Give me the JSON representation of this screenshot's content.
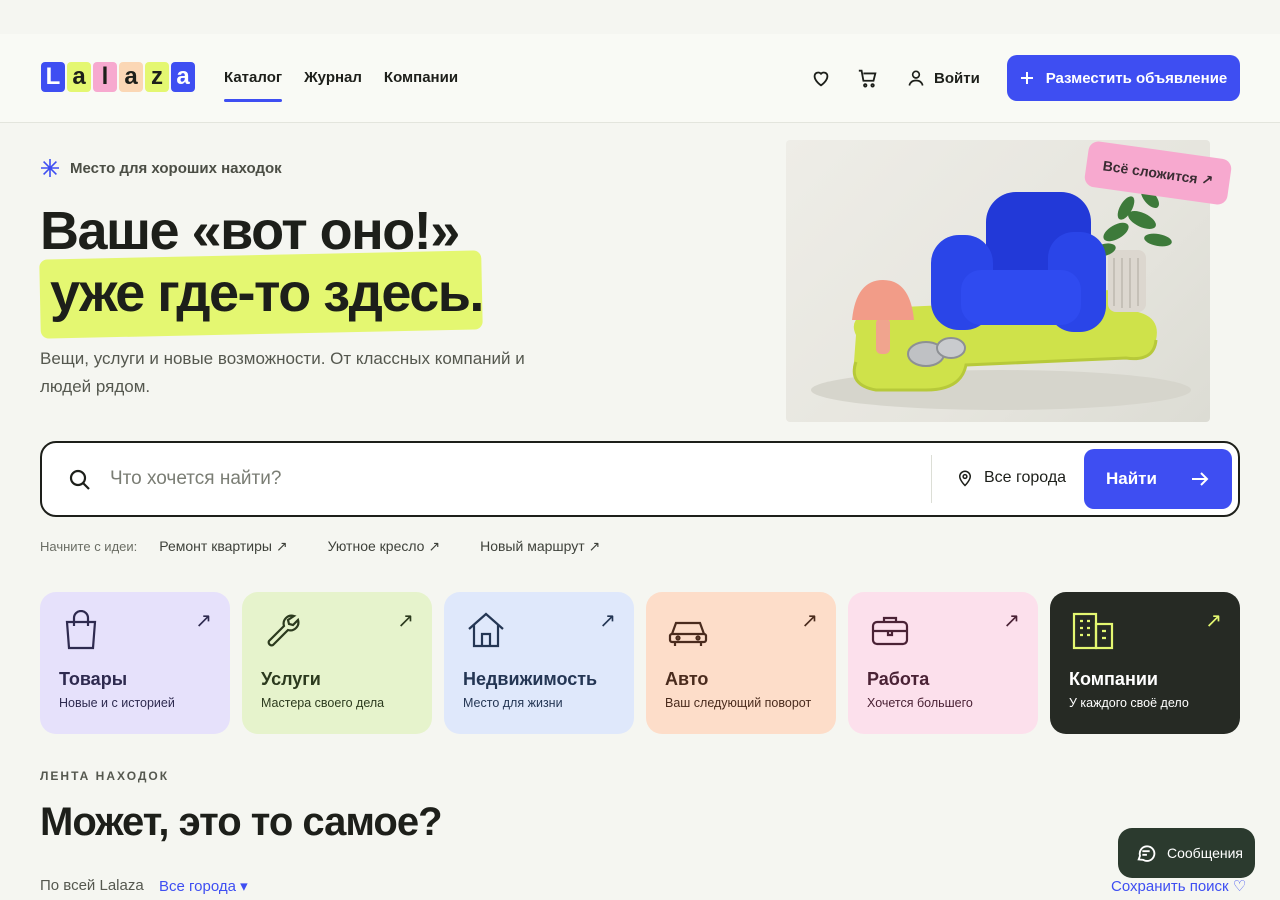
{
  "brand": {
    "logo_letters": [
      "L",
      "a",
      "l",
      "a",
      "z",
      "a"
    ],
    "logo_colors": [
      "#3e4ef2",
      "#e4f771",
      "#f7a9cf",
      "#fbd7b5",
      "#e4f771",
      "#3e4ef2"
    ]
  },
  "nav": {
    "items": [
      {
        "label": "Каталог",
        "active": true
      },
      {
        "label": "Журнал",
        "active": false
      },
      {
        "label": "Компании",
        "active": false
      }
    ]
  },
  "header_actions": {
    "favorites_icon": "heart-icon",
    "cart_icon": "cart-icon",
    "login_label": "Войти",
    "post_button_label": "Разместить объявление"
  },
  "hero": {
    "tagline": "Место для хороших находок",
    "title_line1": "Ваше «вот оно!»",
    "title_line2": "уже где-то здесь.",
    "subtitle": "Вещи, услуги и новые возможности. От классных компаний и людей рядом.",
    "sticker": "Всё сложится ↗"
  },
  "search": {
    "placeholder": "Что хочется найти?",
    "value": "",
    "city_label": "Все города",
    "button_label": "Найти"
  },
  "ideas": {
    "label": "Начните с идеи:",
    "items": [
      "Ремонт квартиры ↗",
      "Уютное кресло ↗",
      "Новый маршрут ↗"
    ]
  },
  "categories": [
    {
      "title": "Товары",
      "subtitle": "Новые и с историей",
      "icon": "shopping-bag-icon",
      "bg": "#e6e1fb",
      "fg": "#2e2a4f"
    },
    {
      "title": "Услуги",
      "subtitle": "Мастера своего дела",
      "icon": "wrench-icon",
      "bg": "#e6f3cc",
      "fg": "#2c3a1e"
    },
    {
      "title": "Недвижимость",
      "subtitle": "Место для жизни",
      "icon": "house-icon",
      "bg": "#dfe8fb",
      "fg": "#243654"
    },
    {
      "title": "Авто",
      "subtitle": "Ваш следующий поворот",
      "icon": "car-icon",
      "bg": "#fdddc9",
      "fg": "#4a2b1d"
    },
    {
      "title": "Работа",
      "subtitle": "Хочется большего",
      "icon": "briefcase-icon",
      "bg": "#fce0ec",
      "fg": "#4a2235"
    },
    {
      "title": "Компании",
      "subtitle": "У каждого своё дело",
      "icon": "building-icon",
      "bg": "#262a24",
      "fg": "#ffffff"
    }
  ],
  "feed": {
    "label": "ЛЕНТА НАХОДОК",
    "title": "Может, это то самое?",
    "scope": "По всей Lalaza",
    "city_filter": "Все города ▾",
    "save_search": "Сохранить поиск ♡"
  },
  "messages": {
    "label": "Сообщения"
  },
  "colors": {
    "accent": "#3e4ef2",
    "highlight": "#e4f771",
    "ink": "#1d1f1a"
  }
}
